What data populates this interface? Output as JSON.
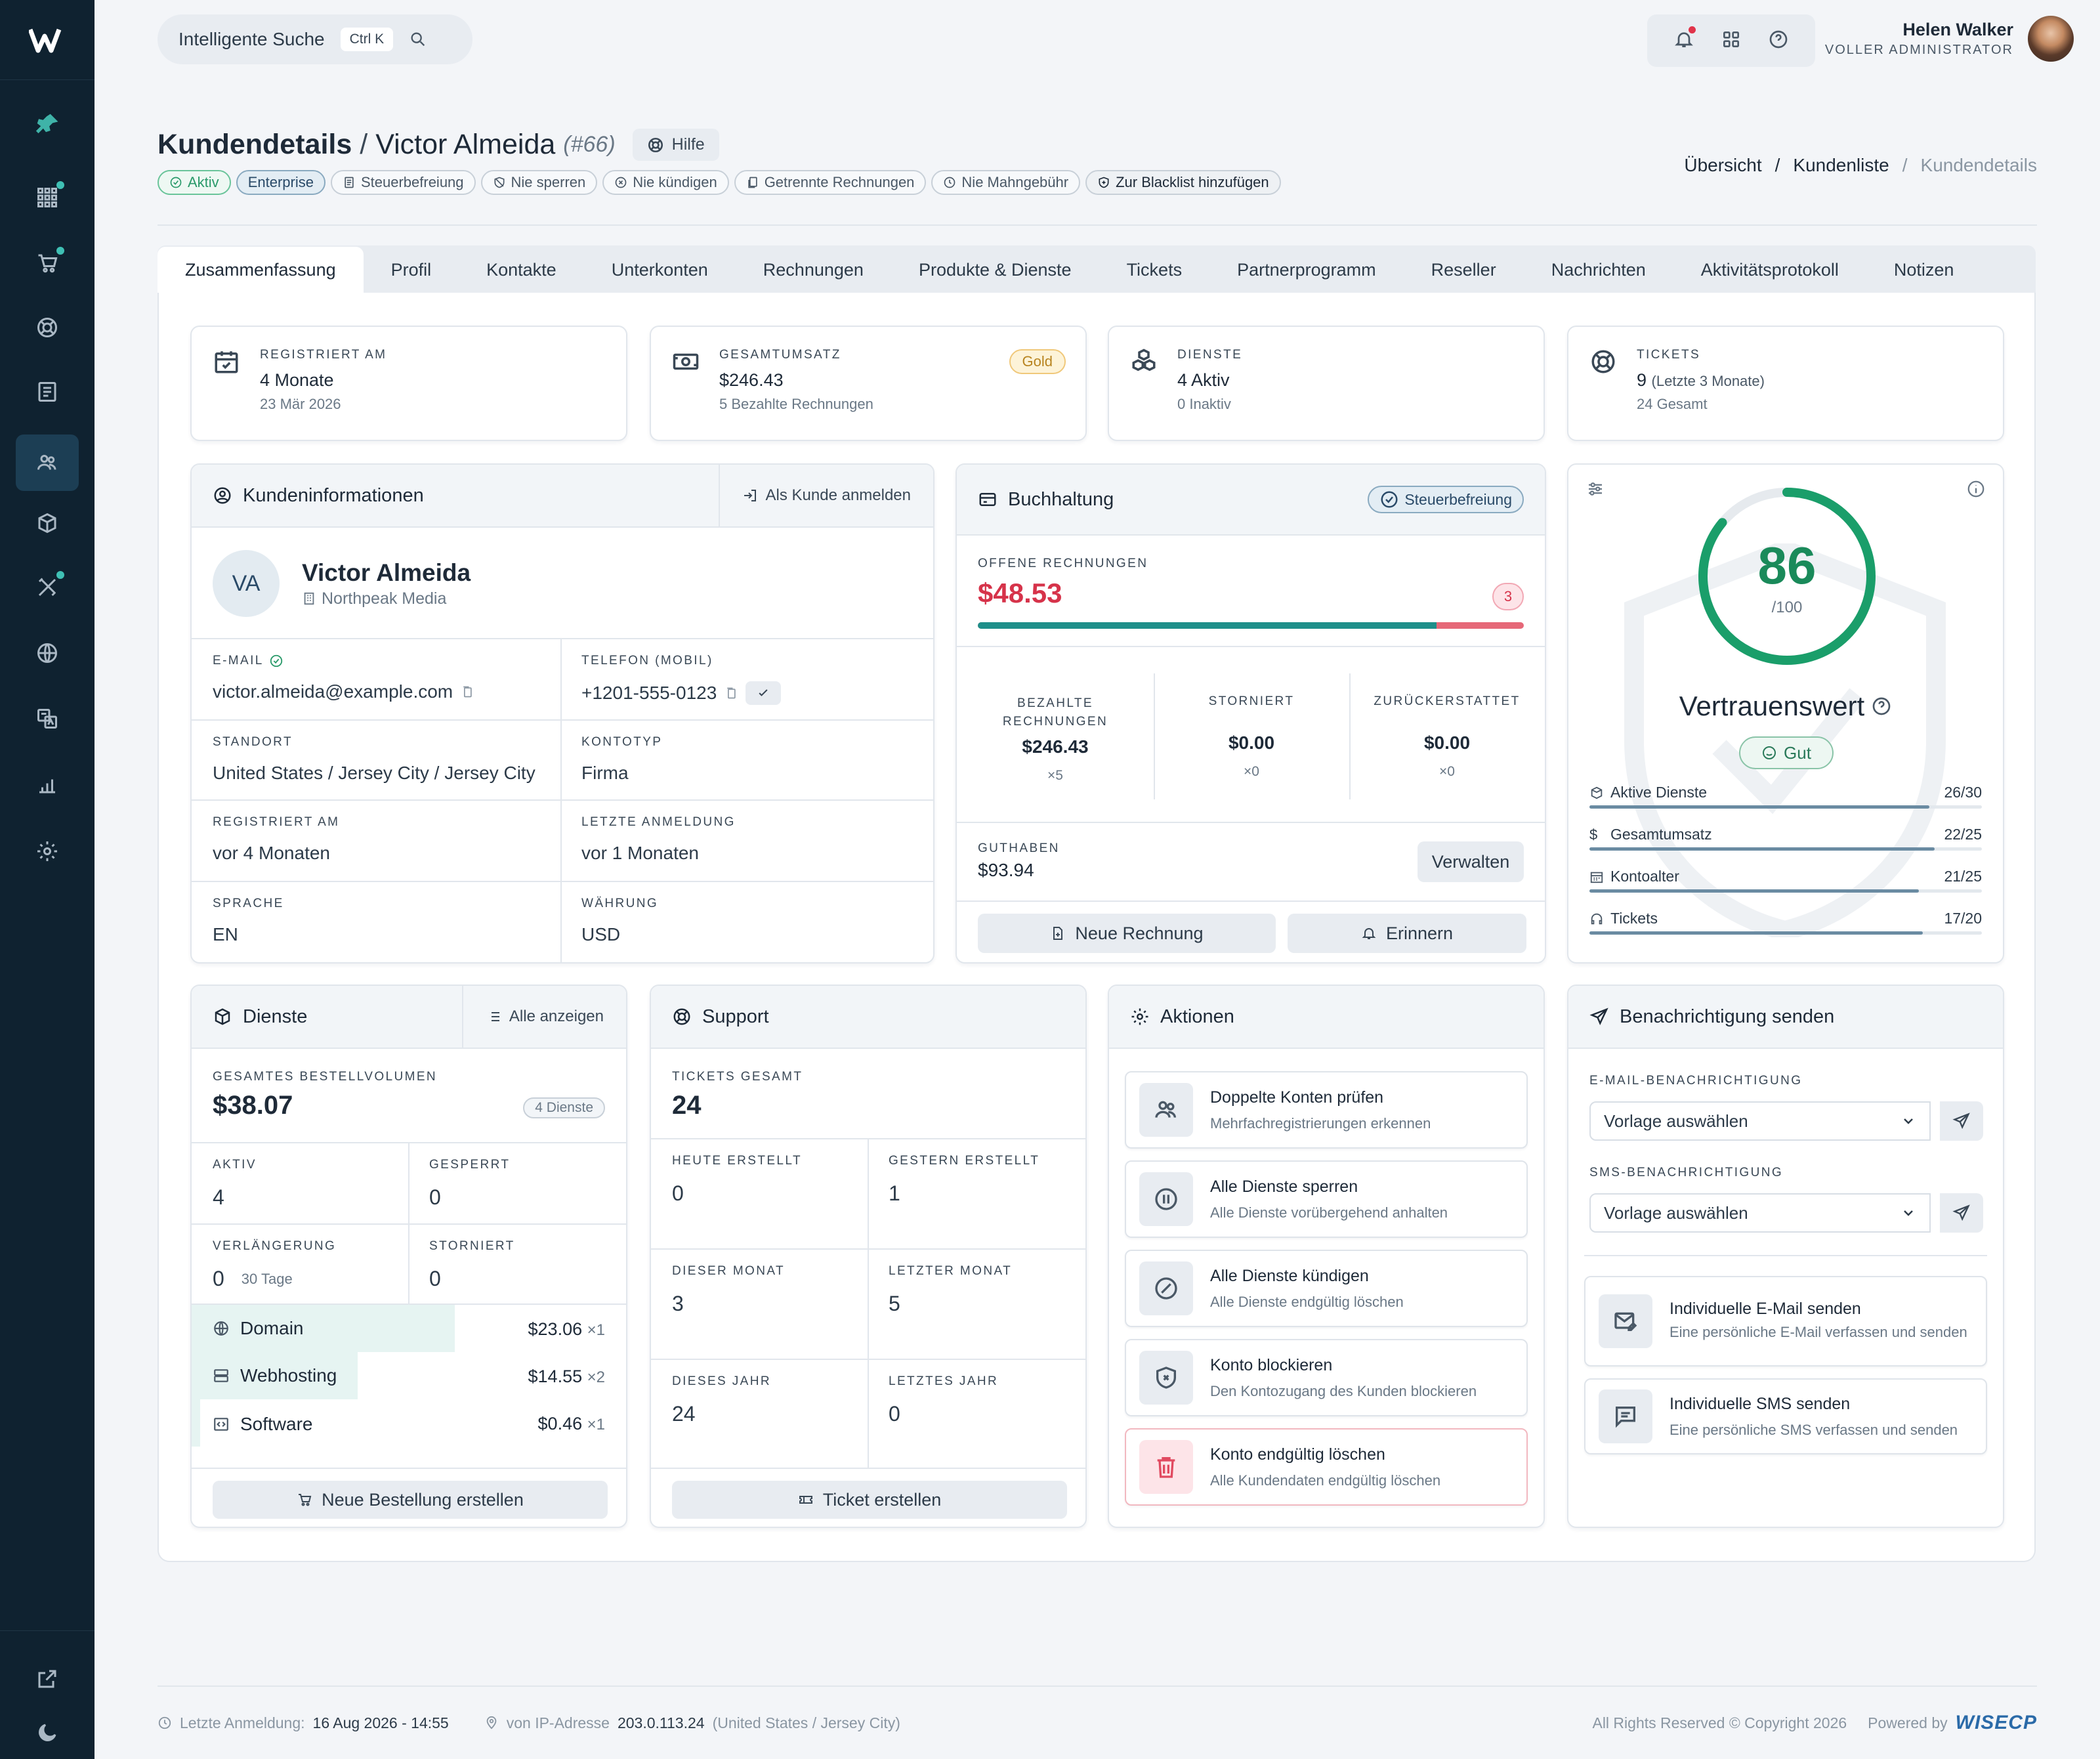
{
  "search": {
    "label": "Intelligente Suche",
    "shortcut": "Ctrl K"
  },
  "user": {
    "name": "Helen Walker",
    "role": "VOLLER ADMINISTRATOR"
  },
  "page": {
    "title": "Kundendetails",
    "separator": "/",
    "customer": "Victor Almeida",
    "id": "(#66)",
    "help": "Hilfe"
  },
  "badges": [
    "Aktiv",
    "Enterprise",
    "Steuerbefreiung",
    "Nie sperren",
    "Nie kündigen",
    "Getrennte Rechnungen",
    "Nie Mahngebühr",
    "Zur Blacklist hinzufügen"
  ],
  "breadcrumb": {
    "items": [
      "Übersicht",
      "Kundenliste",
      "Kundendetails"
    ],
    "sep": "/"
  },
  "tabs": [
    "Zusammenfassung",
    "Profil",
    "Kontakte",
    "Unterkonten",
    "Rechnungen",
    "Produkte & Dienste",
    "Tickets",
    "Partnerprogramm",
    "Reseller",
    "Nachrichten",
    "Aktivitätsprotokoll",
    "Notizen"
  ],
  "stats": [
    {
      "label": "REGISTRIERT AM",
      "value": "4 Monate",
      "sub": "23 Mär 2026",
      "icon": "calendar-icon"
    },
    {
      "label": "GESAMTUMSATZ",
      "value": "$246.43",
      "sub": "5 Bezahlte Rechnungen",
      "badge": "Gold",
      "icon": "money-icon"
    },
    {
      "label": "DIENSTE",
      "value": "4 Aktiv",
      "sub": "0 Inaktiv",
      "icon": "boxes-icon"
    },
    {
      "label": "TICKETS",
      "value": "9",
      "value_note": "(Letzte 3 Monate)",
      "sub": "24 Gesamt",
      "icon": "lifebuoy-icon"
    }
  ],
  "info": {
    "title": "Kundeninformationen",
    "login_as": "Als Kunde anmelden",
    "initials": "VA",
    "name": "Victor Almeida",
    "company": "Northpeak Media",
    "fields": [
      {
        "label": "E-MAIL",
        "value": "victor.almeida@example.com"
      },
      {
        "label": "TELEFON (MOBIL)",
        "value": "+1201-555-0123"
      },
      {
        "label": "STANDORT",
        "value": "United States / Jersey City / Jersey City"
      },
      {
        "label": "KONTOTYP",
        "value": "Firma"
      },
      {
        "label": "REGISTRIERT AM",
        "value": "vor 4 Monaten"
      },
      {
        "label": "LETZTE ANMELDUNG",
        "value": "vor 1 Monaten"
      },
      {
        "label": "SPRACHE",
        "value": "EN"
      },
      {
        "label": "WÄHRUNG",
        "value": "USD"
      }
    ]
  },
  "accounting": {
    "title": "Buchhaltung",
    "tax_badge": "Steuerbefreiung",
    "open_label": "OFFENE RECHNUNGEN",
    "open_value": "$48.53",
    "open_count": "3",
    "paid_ratio": 0.84,
    "cols": [
      {
        "label": "BEZAHLTE RECHNUNGEN",
        "value": "$246.43",
        "count": "×5"
      },
      {
        "label": "STORNIERT",
        "value": "$0.00",
        "count": "×0"
      },
      {
        "label": "ZURÜCKERSTATTET",
        "value": "$0.00",
        "count": "×0"
      }
    ],
    "credit_label": "GUTHABEN",
    "credit_value": "$93.94",
    "manage": "Verwalten",
    "new_invoice": "Neue Rechnung",
    "remind": "Erinnern"
  },
  "trust": {
    "score": "86",
    "max": "/100",
    "score_fraction": 0.86,
    "title": "Vertrauenswert",
    "rating": "Gut",
    "rows": [
      {
        "label": "Aktive Dienste",
        "value": "26/30",
        "ratio": 0.867,
        "icon": "box-icon"
      },
      {
        "label": "Gesamtumsatz",
        "value": "22/25",
        "ratio": 0.88,
        "icon": "dollar-icon"
      },
      {
        "label": "Kontoalter",
        "value": "21/25",
        "ratio": 0.84,
        "icon": "calendar-icon"
      },
      {
        "label": "Tickets",
        "value": "17/20",
        "ratio": 0.85,
        "icon": "headset-icon"
      }
    ]
  },
  "services": {
    "title": "Dienste",
    "show_all": "Alle anzeigen",
    "volume_label": "GESAMTES BESTELLVOLUMEN",
    "volume": "$38.07",
    "count_badge": "4 Dienste",
    "stats": [
      {
        "label": "AKTIV",
        "value": "4"
      },
      {
        "label": "GESPERRT",
        "value": "0"
      },
      {
        "label": "VERLÄNGERUNG",
        "value": "0",
        "note": "30 Tage"
      },
      {
        "label": "STORNIERT",
        "value": "0"
      }
    ],
    "items": [
      {
        "name": "Domain",
        "amount": "$23.06",
        "qty": "×1",
        "share": 0.606
      },
      {
        "name": "Webhosting",
        "amount": "$14.55",
        "qty": "×2",
        "share": 0.382
      },
      {
        "name": "Software",
        "amount": "$0.46",
        "qty": "×1",
        "share": 0.012
      }
    ],
    "new_order": "Neue Bestellung erstellen"
  },
  "support": {
    "title": "Support",
    "total_label": "TICKETS GESAMT",
    "total": "24",
    "stats": [
      {
        "label": "HEUTE ERSTELLT",
        "value": "0"
      },
      {
        "label": "GESTERN ERSTELLT",
        "value": "1"
      },
      {
        "label": "DIESER MONAT",
        "value": "3"
      },
      {
        "label": "LETZTER MONAT",
        "value": "5"
      },
      {
        "label": "DIESES JAHR",
        "value": "24"
      },
      {
        "label": "LETZTES JAHR",
        "value": "0"
      }
    ],
    "create": "Ticket erstellen"
  },
  "actions": {
    "title": "Aktionen",
    "items": [
      {
        "title": "Doppelte Konten prüfen",
        "desc": "Mehrfachregistrierungen erkennen"
      },
      {
        "title": "Alle Dienste sperren",
        "desc": "Alle Dienste vorübergehend anhalten"
      },
      {
        "title": "Alle Dienste kündigen",
        "desc": "Alle Dienste endgültig löschen"
      },
      {
        "title": "Konto blockieren",
        "desc": "Den Kontozugang des Kunden blockieren"
      },
      {
        "title": "Konto endgültig löschen",
        "desc": "Alle Kundendaten endgültig löschen"
      }
    ]
  },
  "notify": {
    "title": "Benachrichtigung senden",
    "email_label": "E-MAIL-BENACHRICHTIGUNG",
    "email_select": "Vorlage auswählen",
    "sms_label": "SMS-BENACHRICHTIGUNG",
    "sms_select": "Vorlage auswählen",
    "custom_email_title": "Individuelle E-Mail senden",
    "custom_email_desc": "Eine persönliche E-Mail verfassen und senden",
    "custom_sms_title": "Individuelle SMS senden",
    "custom_sms_desc": "Eine persönliche SMS verfassen und senden"
  },
  "footer": {
    "last_login_label": "Letzte Anmeldung:",
    "last_login": "16 Aug 2026 - 14:55",
    "ip_label": "von IP-Adresse",
    "ip": "203.0.113.24",
    "ip_loc": "(United States / Jersey City)",
    "copyright": "All Rights Reserved © Copyright 2026",
    "powered": "Powered by",
    "brand": "WISECP"
  },
  "colors": {
    "sidebar": "#0f2230",
    "accent": "#1a9e7a",
    "danger": "#d6334a",
    "teal": "#1e8f8a"
  }
}
